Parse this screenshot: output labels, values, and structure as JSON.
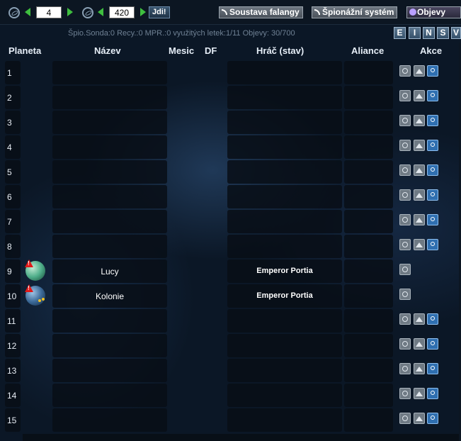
{
  "nav": {
    "galaxy_value": "4",
    "system_value": "420",
    "go_label": "Jdi!",
    "phalanx_label": "Soustava falangy",
    "spy_system_label": "Špionážní systém",
    "discoveries_label": "Objevy"
  },
  "status_text": "Špio.Sonda:0 Recy.:0 MPR.:0 využitých letek:1/11 Objevy: 30/700",
  "filters": [
    "E",
    "I",
    "N",
    "S",
    "V"
  ],
  "headers": {
    "planet": "Planeta",
    "name": "Název",
    "moon": "Mesic",
    "debris": "DF",
    "player": "Hráč (stav)",
    "alliance": "Aliance",
    "actions": "Akce"
  },
  "rows": [
    {
      "pos": "1",
      "planet_name": "",
      "player": "",
      "occupied": false
    },
    {
      "pos": "2",
      "planet_name": "",
      "player": "",
      "occupied": false
    },
    {
      "pos": "3",
      "planet_name": "",
      "player": "",
      "occupied": false
    },
    {
      "pos": "4",
      "planet_name": "",
      "player": "",
      "occupied": false
    },
    {
      "pos": "5",
      "planet_name": "",
      "player": "",
      "occupied": false
    },
    {
      "pos": "6",
      "planet_name": "",
      "player": "",
      "occupied": false
    },
    {
      "pos": "7",
      "planet_name": "",
      "player": "",
      "occupied": false
    },
    {
      "pos": "8",
      "planet_name": "",
      "player": "",
      "occupied": false
    },
    {
      "pos": "9",
      "planet_name": "Lucy",
      "player": "Emperor Portia",
      "occupied": true,
      "planet_icon": "green-planet-icon"
    },
    {
      "pos": "10",
      "planet_name": "Kolonie",
      "player": "Emperor Portia",
      "occupied": true,
      "planet_icon": "blue-planet-icon"
    },
    {
      "pos": "11",
      "planet_name": "",
      "player": "",
      "occupied": false
    },
    {
      "pos": "12",
      "planet_name": "",
      "player": "",
      "occupied": false
    },
    {
      "pos": "13",
      "planet_name": "",
      "player": "",
      "occupied": false
    },
    {
      "pos": "14",
      "planet_name": "",
      "player": "",
      "occupied": false
    },
    {
      "pos": "15",
      "planet_name": "",
      "player": "",
      "occupied": false
    }
  ]
}
